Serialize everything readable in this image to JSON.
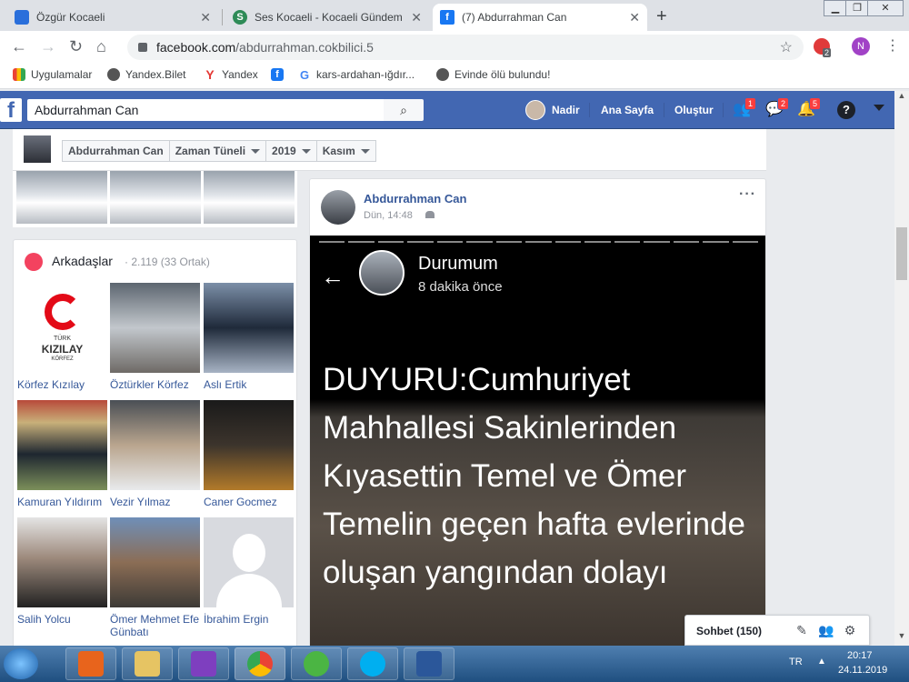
{
  "browser": {
    "tabs": [
      {
        "title": "Özgür Kocaeli",
        "color": "#2a6fdb"
      },
      {
        "title": "Ses Kocaeli - Kocaeli Gündem Ha",
        "color": "#2e8b57"
      },
      {
        "title": "(7) Abdurrahman Can",
        "color": "#1877f2"
      }
    ],
    "address_host": "facebook.com",
    "address_path": "/abdurrahman.cokbilici.5",
    "extension_badge": "2",
    "profile_initial": "N",
    "bookmarks": [
      "Uygulamalar",
      "Yandex.Bilet",
      "Yandex",
      "kars-ardahan-ığdır...",
      "Evinde ölü bulundu!"
    ]
  },
  "facebook": {
    "search_value": "Abdurrahman Can",
    "nav": {
      "user": "Nadir",
      "home": "Ana Sayfa",
      "create": "Oluştur"
    },
    "badges": {
      "friends": "1",
      "messages": "2",
      "notifications": "5"
    },
    "timeline_nav": [
      "Abdurrahman Can",
      "Zaman Tüneli",
      "2019",
      "Kasım"
    ]
  },
  "friends": {
    "title": "Arkadaşlar",
    "count": "· 2.119 (33 Ortak)",
    "items": [
      {
        "name": "Körfez Kızılay",
        "photo": "#ffffff"
      },
      {
        "name": "Öztürkler Körfez",
        "photo": "#8a8f96"
      },
      {
        "name": "Aslı Ertik",
        "photo": "#a7b3c4"
      },
      {
        "name": "Kamuran Yıldırım",
        "photo": "#7c8f5a"
      },
      {
        "name": "Vezir Yılmaz",
        "photo": "#b9a58e"
      },
      {
        "name": "Caner Gocmez",
        "photo": "#3c342c"
      },
      {
        "name": "Salih Yolcu",
        "photo": "#9d8a7c"
      },
      {
        "name": "Ömer Mehmet Efe Günbatı",
        "photo": "#8b6d55"
      },
      {
        "name": "İbrahim Ergin",
        "photo": "#d8dadf"
      }
    ],
    "kizilay_logo": {
      "line1": "TÜRK",
      "line2": "KIZILAY",
      "line3": "KÖRFEZ"
    }
  },
  "post": {
    "author": "Abdurrahman Can",
    "time": "Dün, 14:48",
    "story": {
      "title": "Durumum",
      "subtitle": "8 dakika önce",
      "text": "DUYURU:Cumhuriyet Mahhallesi Sakinlerinden Kıyasettin  Temel ve  Ömer Temelin geçen hafta evlerinde oluşan yangından dolayı"
    }
  },
  "chat": {
    "label": "Sohbet (150)"
  },
  "taskbar": {
    "lang": "TR",
    "time": "20:17",
    "date": "24.11.2019"
  }
}
